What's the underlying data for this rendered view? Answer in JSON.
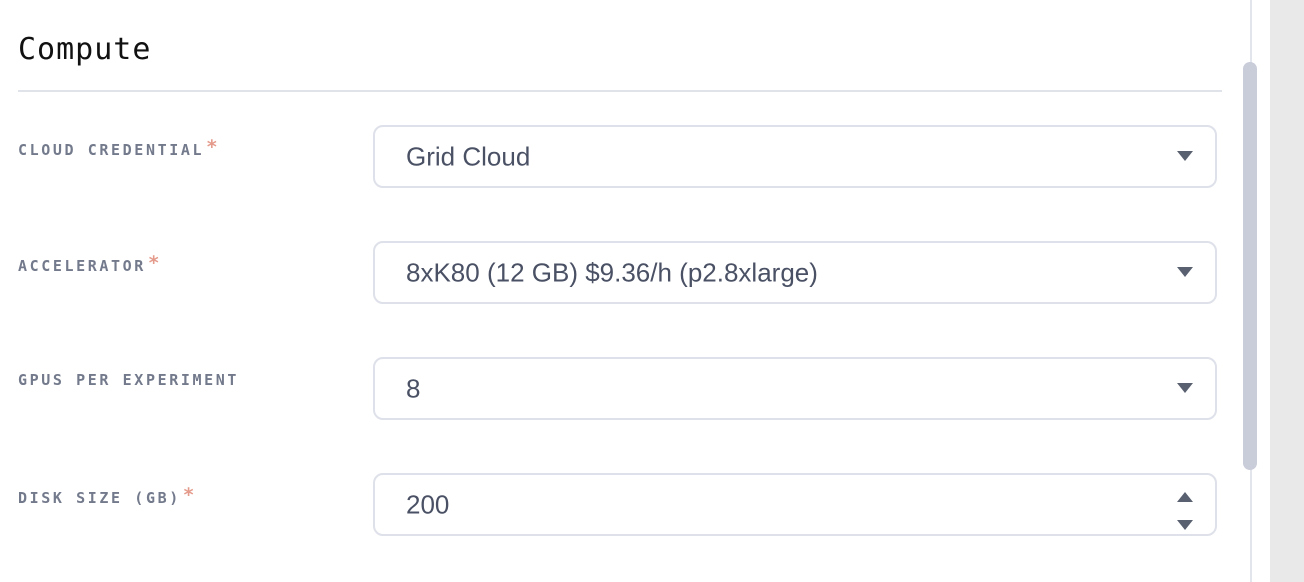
{
  "section": {
    "title": "Compute"
  },
  "fields": [
    {
      "label": "CLOUD CREDENTIAL",
      "required_mark": "*",
      "value": "Grid Cloud",
      "control": "select"
    },
    {
      "label": "ACCELERATOR",
      "required_mark": "*",
      "value": "8xK80 (12 GB) $9.36/h (p2.8xlarge)",
      "control": "select"
    },
    {
      "label": "GPUS PER EXPERIMENT",
      "value": "8",
      "control": "select"
    },
    {
      "label": "DISK SIZE (GB)",
      "required_mark": "*",
      "value": "200",
      "control": "number"
    }
  ],
  "icons": {
    "select_arrow": "chevron-down-icon",
    "spinner_up": "chevron-up-icon",
    "spinner_down": "chevron-down-icon"
  },
  "colors": {
    "label": "#737a8c",
    "required_asterisk": "#e49b8c",
    "value_text": "#4a5165",
    "field_border": "#dfe1ea",
    "scrollbar_thumb": "#c9ccd9"
  }
}
